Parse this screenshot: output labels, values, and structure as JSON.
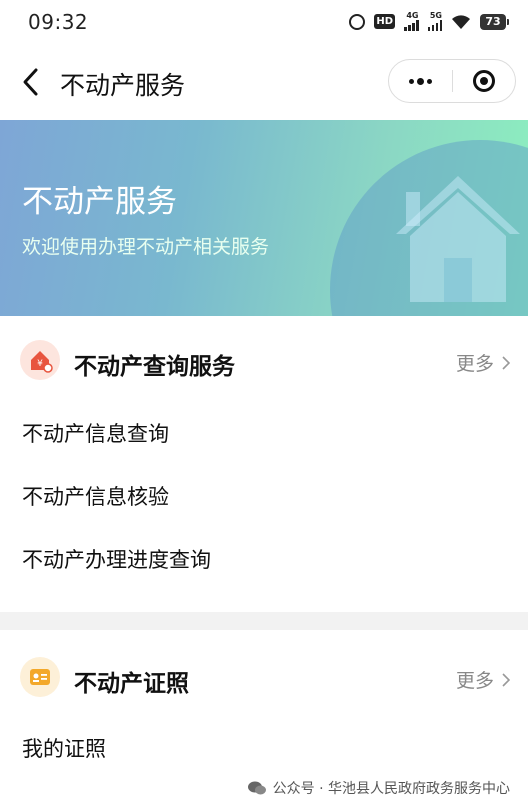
{
  "status_bar": {
    "time": "09:32",
    "hd_label": "HD",
    "net1_label": "4G",
    "net2_label": "5G",
    "battery": "73"
  },
  "nav": {
    "title": "不动产服务"
  },
  "banner": {
    "title": "不动产服务",
    "subtitle": "欢迎使用办理不动产相关服务"
  },
  "sections": [
    {
      "title": "不动产查询服务",
      "more_label": "更多",
      "items": [
        "不动产信息查询",
        "不动产信息核验",
        "不动产办理进度查询"
      ]
    },
    {
      "title": "不动产证照",
      "more_label": "更多",
      "items": [
        "我的证照"
      ]
    }
  ],
  "watermark": "公众号 · 华池县人民政府政务服务中心",
  "colors": {
    "banner_start": "#7ea6d6",
    "banner_end": "#8df0bf",
    "query_icon": "#e8553f",
    "license_icon": "#f3a82a",
    "more_text": "#888888"
  },
  "icons": {
    "back": "chevron-left-icon",
    "menu": "more-dots-icon",
    "close": "target-close-icon",
    "banner_art": "house-icon",
    "query_section": "house-search-icon",
    "license_section": "id-card-icon",
    "more": "chevron-right-icon",
    "watermark": "wechat-icon"
  }
}
